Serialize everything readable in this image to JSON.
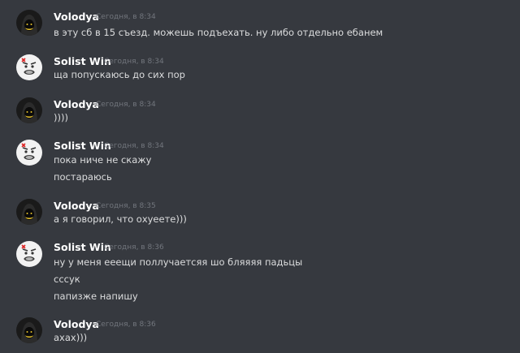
{
  "users": {
    "volodya": {
      "name": "Volodya",
      "avatar_icon": "dark-hooded-figure-icon"
    },
    "solist": {
      "name": "Solist Win",
      "avatar_icon": "rage-face-icon"
    }
  },
  "messages": [
    {
      "author": "Volodya",
      "time": "Сегодня, в 8:34",
      "lines": [
        "в эту сб в 15 съезд. можешь подъехать. ну либо отдельно ебанем"
      ]
    },
    {
      "author": "Solist Win",
      "time": "Сегодня, в 8:34",
      "lines": [
        "ща попускаюсь до сих пор"
      ]
    },
    {
      "author": "Volodya",
      "time": "Сегодня, в 8:34",
      "lines": [
        "))))"
      ]
    },
    {
      "author": "Solist Win",
      "time": "Сегодня, в 8:34",
      "lines": [
        "пока ниче не скажу",
        "постараюсь"
      ]
    },
    {
      "author": "Volodya",
      "time": "Сегодня, в 8:35",
      "lines": [
        "а я говорил, что охуеете)))"
      ]
    },
    {
      "author": "Solist Win",
      "time": "Сегодня, в 8:36",
      "lines": [
        "ну у меня ееещи поллучаетсяя шо бляяяя падьцы",
        "сссук",
        "папизже напишу"
      ]
    },
    {
      "author": "Volodya",
      "time": "Сегодня, в 8:36",
      "lines": [
        "ахах)))"
      ]
    }
  ]
}
